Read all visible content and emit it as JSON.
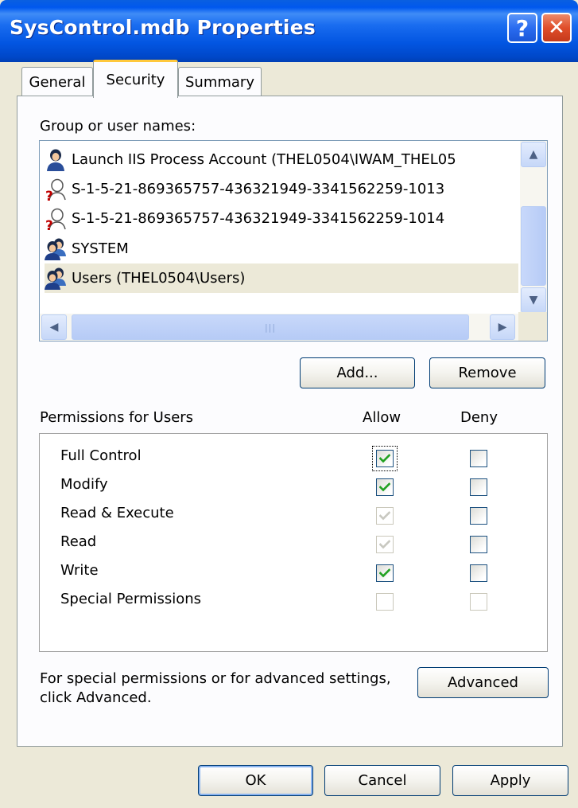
{
  "window": {
    "title": "SysControl.mdb Properties"
  },
  "titlebar": {
    "help_label": "?",
    "close_label": "✕"
  },
  "tabs": [
    {
      "label": "General"
    },
    {
      "label": "Security"
    },
    {
      "label": "Summary"
    }
  ],
  "users": {
    "label": "Group or user names:",
    "items": [
      {
        "name": "Launch IIS Process Account (THEL0504\\IWAM_THEL05",
        "icon": "user-icon",
        "selected": false
      },
      {
        "name": "S-1-5-21-869365757-436321949-3341562259-1013",
        "icon": "unknown-user-icon",
        "selected": false
      },
      {
        "name": "S-1-5-21-869365757-436321949-3341562259-1014",
        "icon": "unknown-user-icon",
        "selected": false
      },
      {
        "name": "SYSTEM",
        "icon": "group-icon",
        "selected": false
      },
      {
        "name": "Users (THEL0504\\Users)",
        "icon": "group-icon",
        "selected": true
      }
    ]
  },
  "buttons": {
    "add": "Add...",
    "remove": "Remove",
    "advanced": "Advanced",
    "ok": "OK",
    "cancel": "Cancel",
    "apply": "Apply"
  },
  "permissions": {
    "label": "Permissions for Users",
    "allow_label": "Allow",
    "deny_label": "Deny",
    "items": [
      {
        "name": "Full Control",
        "allow": true,
        "allow_disabled": false,
        "deny": false,
        "deny_disabled": false
      },
      {
        "name": "Modify",
        "allow": true,
        "allow_disabled": false,
        "deny": false,
        "deny_disabled": false
      },
      {
        "name": "Read & Execute",
        "allow": true,
        "allow_disabled": true,
        "deny": false,
        "deny_disabled": false
      },
      {
        "name": "Read",
        "allow": true,
        "allow_disabled": true,
        "deny": false,
        "deny_disabled": false
      },
      {
        "name": "Write",
        "allow": true,
        "allow_disabled": false,
        "deny": false,
        "deny_disabled": false
      },
      {
        "name": "Special Permissions",
        "allow": false,
        "allow_disabled": true,
        "deny": false,
        "deny_disabled": true
      }
    ]
  },
  "advanced_text": {
    "line1": "For special permissions or for advanced settings,",
    "line2": "click Advanced."
  }
}
